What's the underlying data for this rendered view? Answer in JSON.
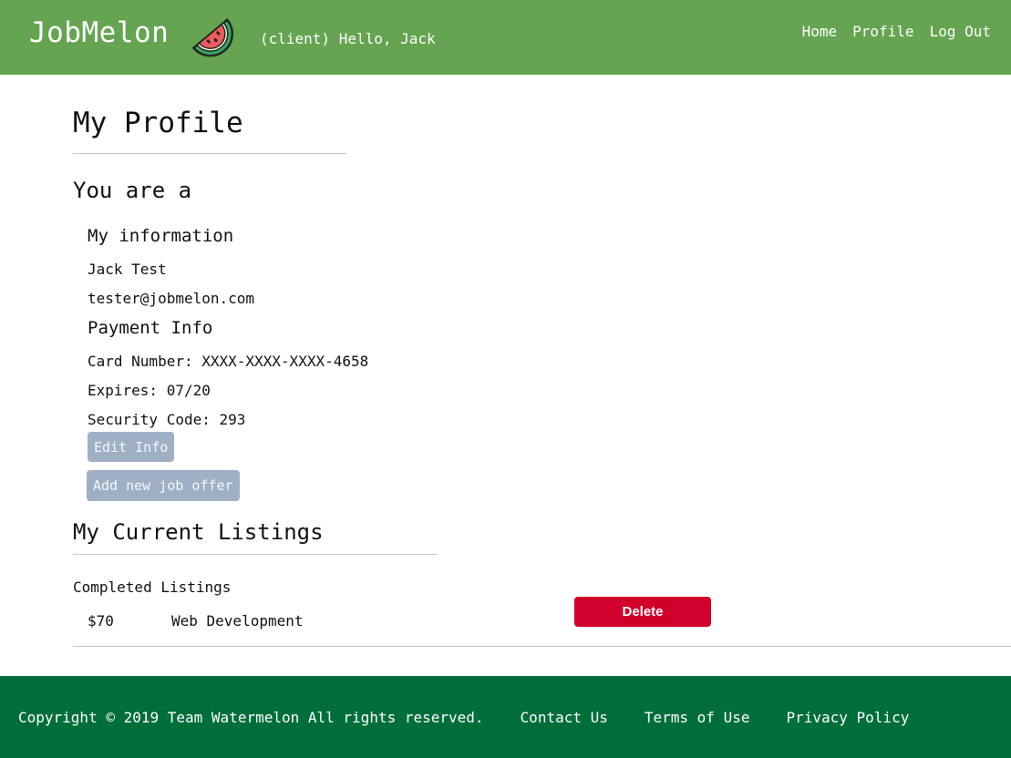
{
  "header": {
    "brand": "JobMelon",
    "logo_icon": "watermelon-slice-icon",
    "greeting": "(client) Hello, Jack",
    "nav": [
      "Home",
      "Profile",
      "Log Out"
    ],
    "bg_color": "#65a451"
  },
  "profile": {
    "title": "My Profile",
    "role_line": "You are a",
    "info_heading": "My information",
    "name": "Jack Test",
    "email": "tester@jobmelon.com",
    "payment_heading": "Payment Info",
    "card_number": "Card Number: XXXX-XXXX-XXXX-4658",
    "expires": "Expires: 07/20",
    "security_code": "Security Code: 293",
    "edit_button": "Edit Info",
    "add_job_button": "Add new job offer"
  },
  "listings": {
    "title": "My Current Listings",
    "completed_label": "Completed Listings",
    "items": [
      {
        "price": "$70",
        "title": "Web Development",
        "delete_label": "Delete"
      }
    ],
    "delete_color": "#d1002b"
  },
  "footer": {
    "copyright": "Copyright © 2019 Team Watermelon All rights reserved.",
    "links": [
      "Contact Us",
      "Terms of Use",
      "Privacy Policy"
    ],
    "bg_color": "#006e3a"
  }
}
